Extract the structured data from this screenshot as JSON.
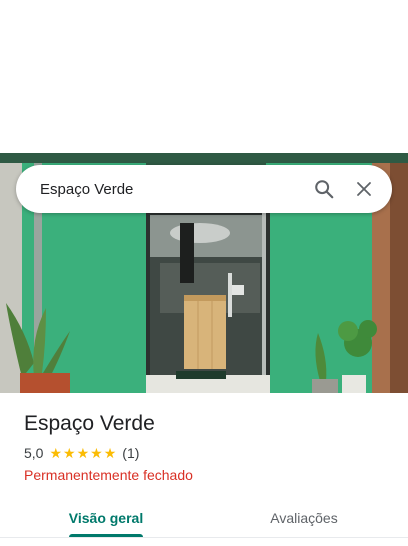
{
  "search": {
    "value": "Espaço Verde"
  },
  "place": {
    "name": "Espaço Verde",
    "rating": "5,0",
    "stars": 5,
    "review_count": "(1)",
    "status": "Permanentemente fechado"
  },
  "tabs": [
    {
      "label": "Visão geral",
      "selected": true
    },
    {
      "label": "Avaliações",
      "selected": false
    }
  ],
  "colors": {
    "accent": "#00796b",
    "star": "#fbbc04",
    "closed": "#d93025",
    "facade_green": "#3cb07a"
  },
  "icons": {
    "search": "search-icon",
    "close": "close-icon",
    "star": "star-icon"
  }
}
